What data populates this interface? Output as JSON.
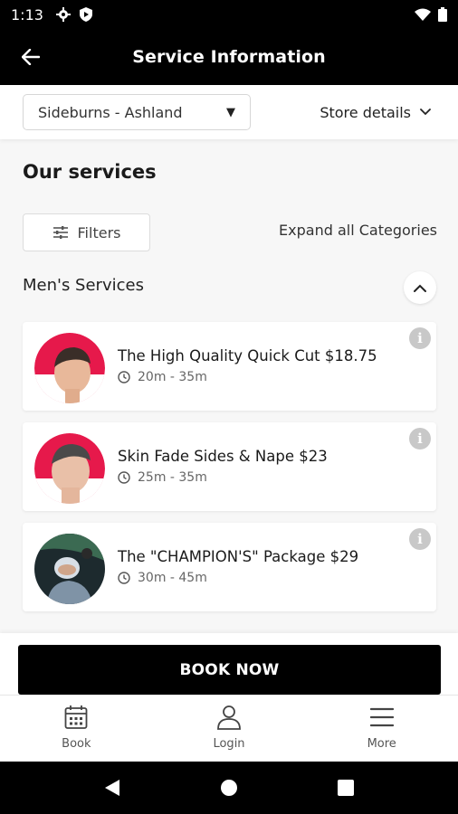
{
  "status_bar": {
    "time": "1:13"
  },
  "app_bar": {
    "title": "Service Information"
  },
  "store": {
    "selected": "Sideburns - Ashland",
    "details_label": "Store details"
  },
  "services_heading": "Our services",
  "filters_label": "Filters",
  "expand_all_label": "Expand all Categories",
  "category": {
    "title": "Men's Services",
    "services": [
      {
        "name": "The High Quality Quick Cut $18.75",
        "duration": "20m - 35m"
      },
      {
        "name": "Skin Fade Sides & Nape $23",
        "duration": "25m - 35m"
      },
      {
        "name": "The \"CHAMPION'S\" Package $29",
        "duration": "30m - 45m"
      }
    ]
  },
  "book_now_label": "BOOK NOW",
  "bottom_nav": {
    "book": "Book",
    "login": "Login",
    "more": "More"
  },
  "colors": {
    "accent": "#e6194b",
    "black": "#000000"
  }
}
